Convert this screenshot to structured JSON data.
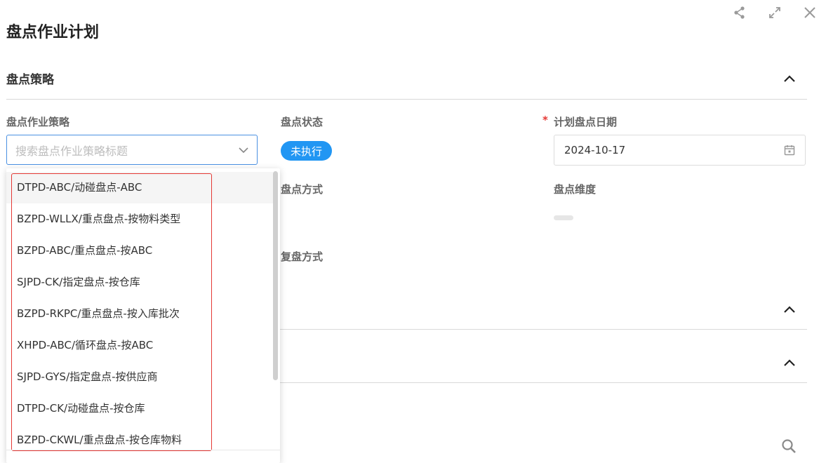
{
  "page": {
    "title": "盘点作业计划"
  },
  "top_icons": [
    "share-icon",
    "expand-icon",
    "close-icon"
  ],
  "section": {
    "title": "盘点策略"
  },
  "fields": {
    "strategy": {
      "label": "盘点作业策略",
      "placeholder": "搜索盘点作业策略标题"
    },
    "status": {
      "label": "盘点状态",
      "value": "未执行"
    },
    "planned_date": {
      "label": "计划盘点日期",
      "required_mark": "*",
      "value": "2024-10-17"
    },
    "method": {
      "label": "盘点方式"
    },
    "dimension": {
      "label": "盘点维度"
    },
    "recheck_method": {
      "label": "复盘方式"
    }
  },
  "dropdown": {
    "options": [
      "DTPD-ABC/动碰盘点-ABC",
      "BZPD-WLLX/重点盘点-按物料类型",
      "BZPD-ABC/重点盘点-按ABC",
      "SJPD-CK/指定盘点-按仓库",
      "BZPD-RKPC/重点盘点-按入库批次",
      "XHPD-ABC/循环盘点-按ABC",
      "SJPD-GYS/指定盘点-按供应商",
      "DTPD-CK/动碰盘点-按仓库",
      "BZPD-CKWL/重点盘点-按仓库物料"
    ],
    "active_index": 0
  },
  "colors": {
    "accent": "#2196f3",
    "required": "#e53935",
    "highlight_border": "#e53935"
  }
}
